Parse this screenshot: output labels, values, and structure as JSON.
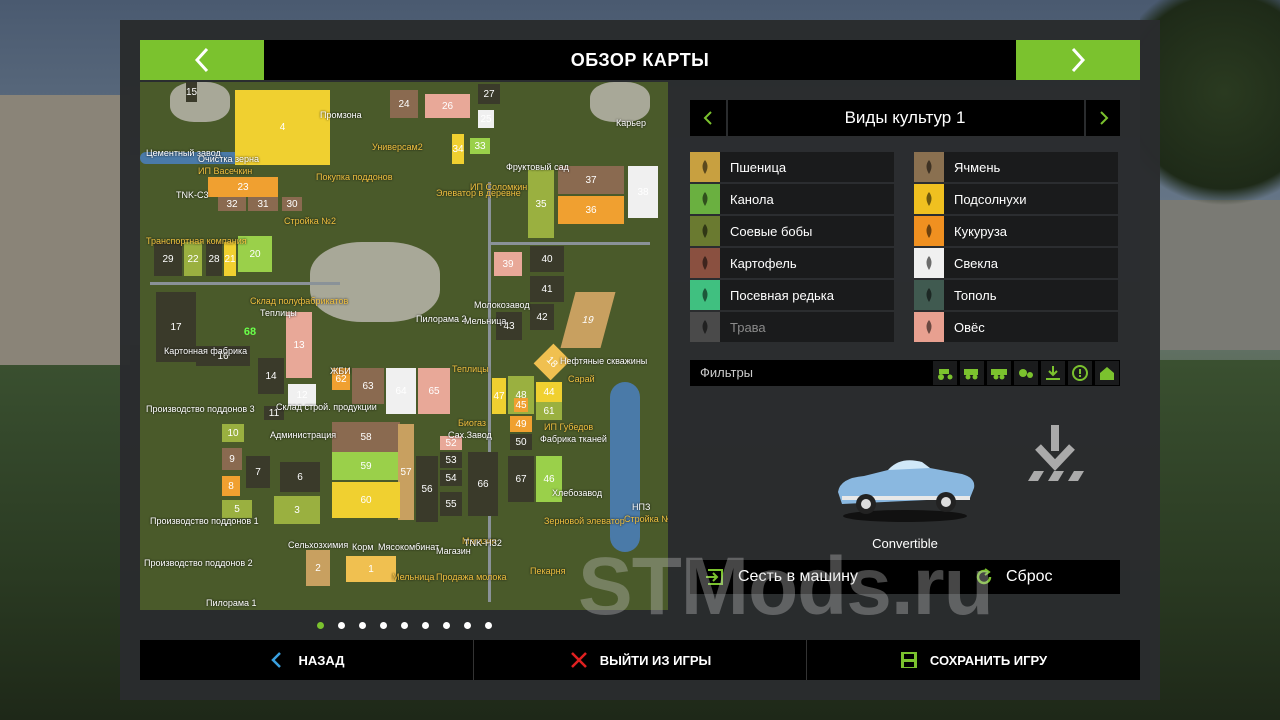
{
  "header": {
    "title": "ОБЗОР КАРТЫ"
  },
  "map": {
    "fields": [
      {
        "id": "4",
        "color": "#f0d030"
      },
      {
        "id": "24",
        "color": "#8a6a50"
      },
      {
        "id": "26",
        "color": "#e8a898"
      },
      {
        "id": "27",
        "color": "#3a3a2a"
      },
      {
        "id": "25",
        "color": "#f0f0f0"
      },
      {
        "id": "34",
        "color": "#f0d030"
      },
      {
        "id": "33",
        "color": "#9ad04a"
      },
      {
        "id": "23",
        "color": "#f0a030"
      },
      {
        "id": "32",
        "color": "#8a6a50"
      },
      {
        "id": "31",
        "color": "#8a6a50"
      },
      {
        "id": "30",
        "color": "#8a6a50"
      },
      {
        "id": "37",
        "color": "#8a6a50"
      },
      {
        "id": "38",
        "color": "#f0f0f0"
      },
      {
        "id": "36",
        "color": "#f0a030"
      },
      {
        "id": "35",
        "color": "#9ab040"
      },
      {
        "id": "29",
        "color": "#3a3a2a"
      },
      {
        "id": "22",
        "color": "#9ab040"
      },
      {
        "id": "28",
        "color": "#3a3a2a"
      },
      {
        "id": "21",
        "color": "#f0d030"
      },
      {
        "id": "20",
        "color": "#9ad04a"
      },
      {
        "id": "39",
        "color": "#e8a898"
      },
      {
        "id": "40",
        "color": "#3a3a2a"
      },
      {
        "id": "41",
        "color": "#3a3a2a"
      },
      {
        "id": "42",
        "color": "#3a3a2a"
      },
      {
        "id": "43",
        "color": "#3a3a2a"
      },
      {
        "id": "19",
        "color": "#c8a060"
      },
      {
        "id": "17",
        "color": "#3a3a2a"
      },
      {
        "id": "68",
        "color": "#4a5a2a"
      },
      {
        "id": "13",
        "color": "#e8a898"
      },
      {
        "id": "16",
        "color": "#3a3a2a"
      },
      {
        "id": "15",
        "color": "#3a3a2a"
      },
      {
        "id": "14",
        "color": "#3a3a2a"
      },
      {
        "id": "12",
        "color": "#f0f0f0"
      },
      {
        "id": "62",
        "color": "#f0a030"
      },
      {
        "id": "63",
        "color": "#8a6a50"
      },
      {
        "id": "64",
        "color": "#f0f0f0"
      },
      {
        "id": "65",
        "color": "#e8a898"
      },
      {
        "id": "18",
        "color": "#f0c050"
      },
      {
        "id": "44",
        "color": "#f0d030"
      },
      {
        "id": "47",
        "color": "#f0d030"
      },
      {
        "id": "48",
        "color": "#9ab040"
      },
      {
        "id": "61",
        "color": "#9ab040"
      },
      {
        "id": "49",
        "color": "#f0a030"
      },
      {
        "id": "50",
        "color": "#3a3a2a"
      },
      {
        "id": "10",
        "color": "#9ab040"
      },
      {
        "id": "58",
        "color": "#8a6a50"
      },
      {
        "id": "52",
        "color": "#e8a898"
      },
      {
        "id": "9",
        "color": "#8a6a50"
      },
      {
        "id": "7",
        "color": "#3a3a2a"
      },
      {
        "id": "6",
        "color": "#3a3a2a"
      },
      {
        "id": "59",
        "color": "#9ad04a"
      },
      {
        "id": "57",
        "color": "#c8a060"
      },
      {
        "id": "53",
        "color": "#3a3a2a"
      },
      {
        "id": "54",
        "color": "#3a3a2a"
      },
      {
        "id": "56",
        "color": "#3a3a2a"
      },
      {
        "id": "66",
        "color": "#3a3a2a"
      },
      {
        "id": "67",
        "color": "#3a3a2a"
      },
      {
        "id": "46",
        "color": "#9ad04a"
      },
      {
        "id": "8",
        "color": "#f0a030"
      },
      {
        "id": "60",
        "color": "#f0d030"
      },
      {
        "id": "55",
        "color": "#3a3a2a"
      },
      {
        "id": "5",
        "color": "#9ab040"
      },
      {
        "id": "3",
        "color": "#9ab040"
      },
      {
        "id": "2",
        "color": "#c8a060"
      },
      {
        "id": "1",
        "color": "#f0c050"
      },
      {
        "id": "11",
        "color": "#3a3a2a"
      },
      {
        "id": "45",
        "color": "#f0a030"
      }
    ],
    "labels": {
      "promzona": "Промзона",
      "karier": "Карьер",
      "cement": "Цементный завод",
      "ochistka": "Очистка зерна",
      "ip_vas": "ИП Васечкин",
      "tnk": "TNK-С3",
      "univers": "Универсам2",
      "fruit": "Фруктовый сад",
      "pokupka": "Покупка поддонов",
      "elevator": "Элеватор в деревне",
      "ip_sol": "ИП Соломкин",
      "stroyka": "Стройка №2",
      "transport": "Транспортная компания",
      "skl": "Склад полуфабрикатов",
      "teplicy": "Теплицы",
      "molokozavod": "Молокозавод",
      "pilorama2": "Пилорама 2",
      "melnica": "Мельница",
      "neft": "Нефтяные скважины",
      "karton": "Картонная фабрика",
      "zhbi": "ЖБИ",
      "teplicy2": "Теплицы",
      "saray": "Сарай",
      "pod3": "Производство поддонов 3",
      "sklad_str": "Склад строй. продукции",
      "ip_gub": "ИП Губедов",
      "biogaz": "Биогаз",
      "administr": "Администрация",
      "saxzavod": "Сах.Завод",
      "tkani": "Фабрика тканей",
      "hleb": "Хлебозавод",
      "nps": "НПЗ",
      "stroyka4": "Стройка №4",
      "pod1": "Производство поддонов 1",
      "zernovoy": "Зерновой элеватор",
      "selhoz": "Сельхозхимия",
      "korm": "Корм",
      "myaso": "Мясокомбинат",
      "magazin": "Магазин",
      "magazin2": "Магазин",
      "pod2": "Производство поддонов 2",
      "pekarnya": "Пекарня",
      "melnica2": "Мельница",
      "moloka": "Продажа молока",
      "pilorama1": "Пилорама 1",
      "tnk2": "TNK-НЗ2"
    }
  },
  "pagination": {
    "count": 9,
    "active": 0
  },
  "crops_panel": {
    "title": "Виды культур 1",
    "items": [
      {
        "name": "Пшеница",
        "color": "#c8a040",
        "icon": "wheat-icon"
      },
      {
        "name": "Ячмень",
        "color": "#8a7050",
        "icon": "barley-icon"
      },
      {
        "name": "Канола",
        "color": "#6ab040",
        "icon": "canola-icon"
      },
      {
        "name": "Подсолнухи",
        "color": "#f0c020",
        "icon": "sunflower-icon"
      },
      {
        "name": "Соевые бобы",
        "color": "#6a7a30",
        "icon": "soybean-icon"
      },
      {
        "name": "Кукуруза",
        "color": "#f09020",
        "icon": "corn-icon"
      },
      {
        "name": "Картофель",
        "color": "#8a5040",
        "icon": "potato-icon"
      },
      {
        "name": "Свекла",
        "color": "#f0f0f0",
        "icon": "sugarbeet-icon"
      },
      {
        "name": "Посевная редька",
        "color": "#40c080",
        "icon": "oilradish-icon"
      },
      {
        "name": "Тополь",
        "color": "#405a50",
        "icon": "poplar-icon"
      },
      {
        "name": "Трава",
        "color": "#4a4a4a",
        "icon": "grass-icon",
        "dim": true
      },
      {
        "name": "Овёс",
        "color": "#e8a090",
        "icon": "oat-icon"
      }
    ]
  },
  "filters": {
    "label": "Фильтры",
    "buttons": [
      "tractor-icon",
      "harvester-icon",
      "trailer-icon",
      "gears-icon",
      "download-icon",
      "alert-icon",
      "home-icon"
    ]
  },
  "vehicle": {
    "name": "Convertible"
  },
  "actions": {
    "enter": "Сесть в машину",
    "reset": "Сброс"
  },
  "footer": {
    "back": "НАЗАД",
    "exit": "ВЫЙТИ ИЗ ИГРЫ",
    "save": "СОХРАНИТЬ ИГРУ"
  },
  "colors": {
    "accent": "#7bc22e",
    "exit": "#e02020",
    "back": "#3aa0e0"
  },
  "watermark": "STMods.ru"
}
